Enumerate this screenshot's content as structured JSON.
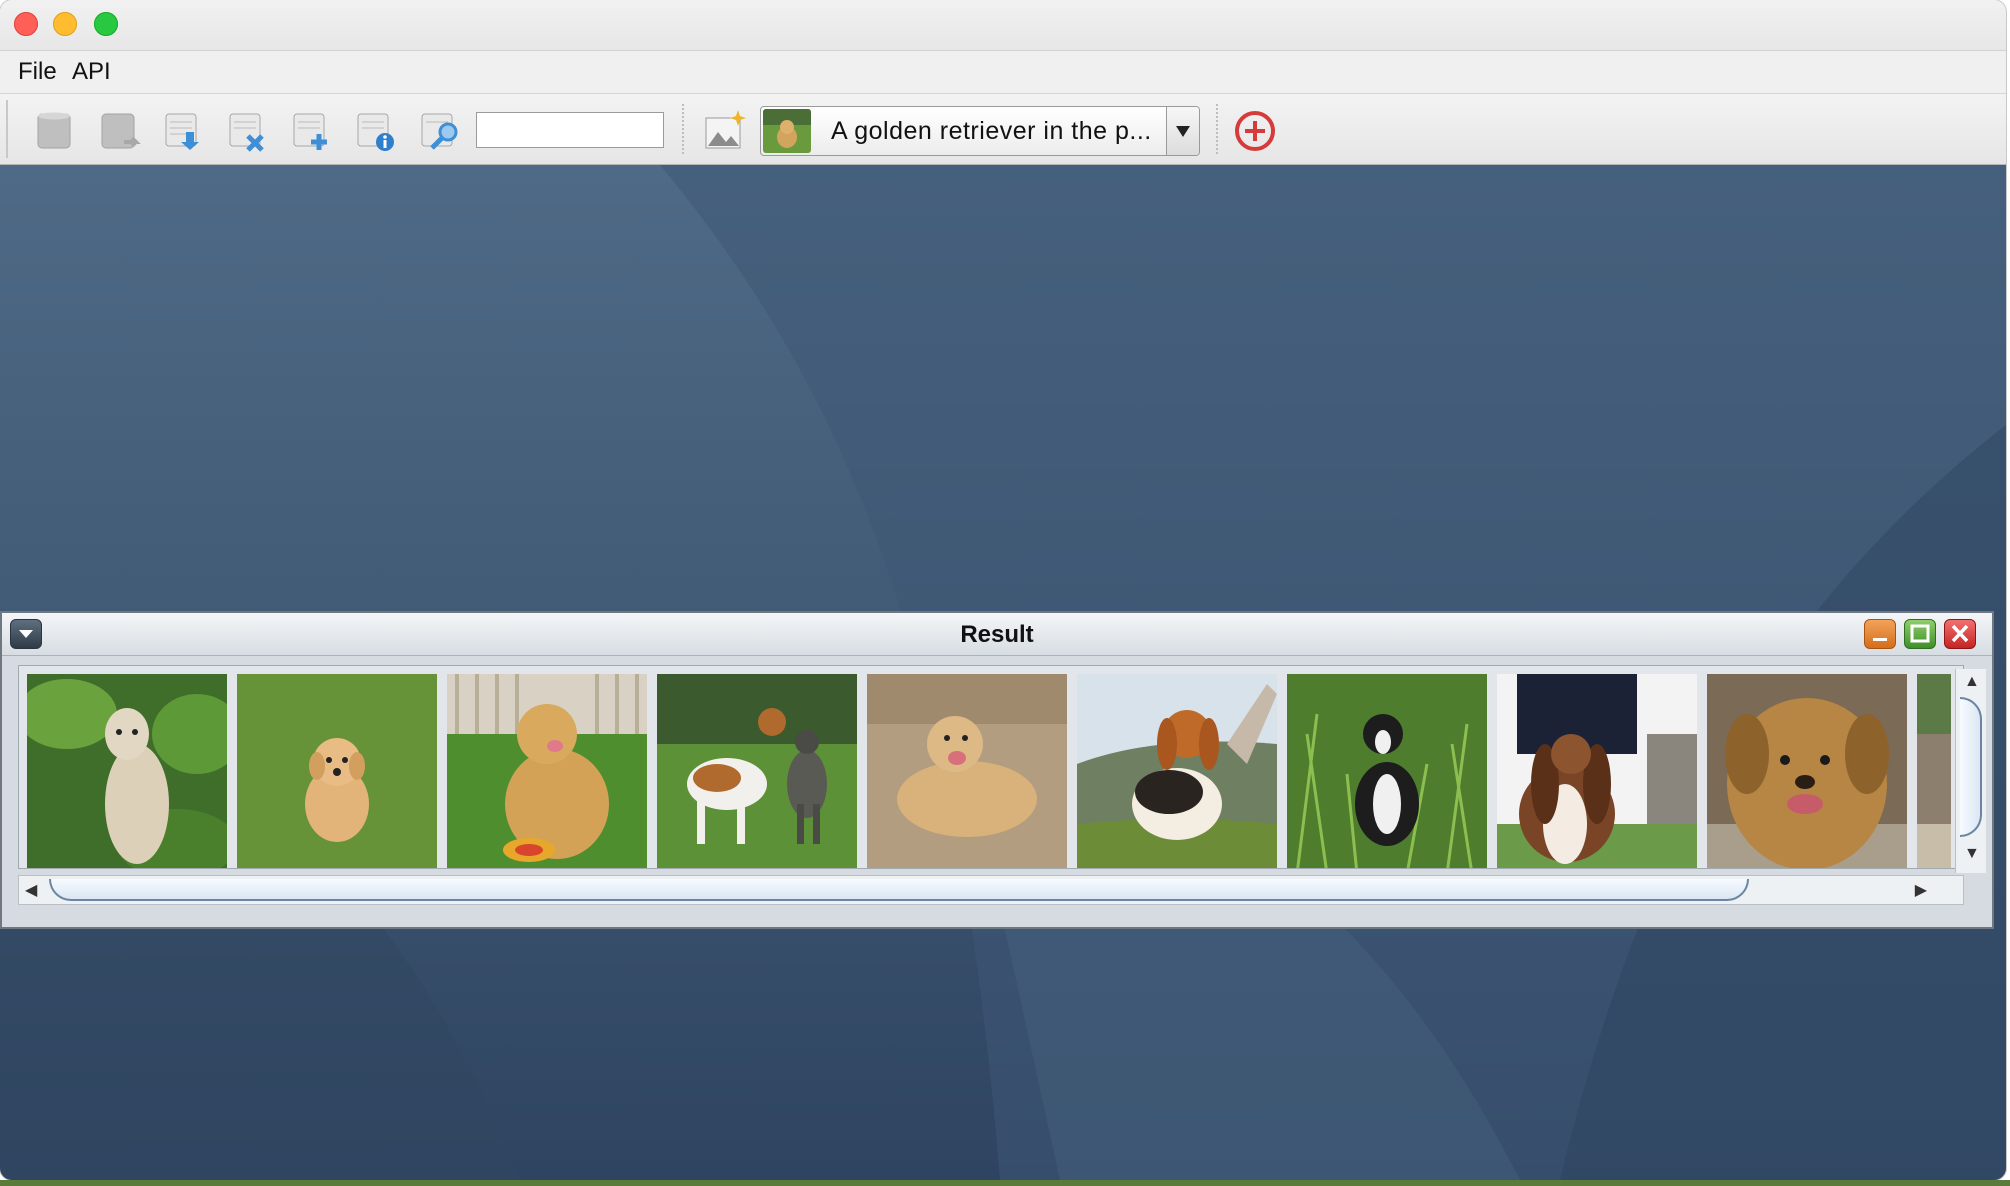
{
  "menu": {
    "file": "File",
    "api": "API"
  },
  "toolbar": {
    "buttons": [
      {
        "name": "database-icon"
      },
      {
        "name": "database-export-icon"
      },
      {
        "name": "database-download-icon"
      },
      {
        "name": "database-delete-icon"
      },
      {
        "name": "database-add-icon"
      },
      {
        "name": "database-info-icon"
      },
      {
        "name": "database-search-icon"
      },
      {
        "name": "image-sparkle-icon"
      },
      {
        "name": "add-circle-icon"
      }
    ],
    "search_value": "",
    "combo_text": "A golden retriever in the p...",
    "accent": "#d63b3b"
  },
  "result_window": {
    "title": "Result",
    "images": [
      {
        "name": "whippet-in-leaves"
      },
      {
        "name": "golden-retriever-puppy-on-grass"
      },
      {
        "name": "golden-retriever-with-frisbee"
      },
      {
        "name": "two-dogs-playing"
      },
      {
        "name": "golden-retriever-running-on-sand"
      },
      {
        "name": "basset-hound-on-hill"
      },
      {
        "name": "border-collie-in-grass"
      },
      {
        "name": "basset-hound-with-person"
      },
      {
        "name": "golden-dog-portrait"
      },
      {
        "name": "partial-dog-image"
      }
    ]
  }
}
